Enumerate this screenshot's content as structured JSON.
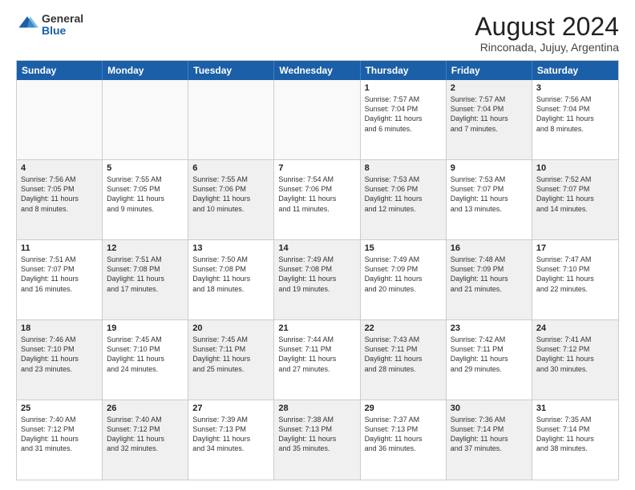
{
  "logo": {
    "general": "General",
    "blue": "Blue"
  },
  "header": {
    "month_year": "August 2024",
    "location": "Rinconada, Jujuy, Argentina"
  },
  "days_of_week": [
    "Sunday",
    "Monday",
    "Tuesday",
    "Wednesday",
    "Thursday",
    "Friday",
    "Saturday"
  ],
  "rows": [
    [
      {
        "day": "",
        "info": "",
        "shaded": false,
        "empty": true
      },
      {
        "day": "",
        "info": "",
        "shaded": false,
        "empty": true
      },
      {
        "day": "",
        "info": "",
        "shaded": false,
        "empty": true
      },
      {
        "day": "",
        "info": "",
        "shaded": false,
        "empty": true
      },
      {
        "day": "1",
        "info": "Sunrise: 7:57 AM\nSunset: 7:04 PM\nDaylight: 11 hours\nand 6 minutes.",
        "shaded": false,
        "empty": false
      },
      {
        "day": "2",
        "info": "Sunrise: 7:57 AM\nSunset: 7:04 PM\nDaylight: 11 hours\nand 7 minutes.",
        "shaded": true,
        "empty": false
      },
      {
        "day": "3",
        "info": "Sunrise: 7:56 AM\nSunset: 7:04 PM\nDaylight: 11 hours\nand 8 minutes.",
        "shaded": false,
        "empty": false
      }
    ],
    [
      {
        "day": "4",
        "info": "Sunrise: 7:56 AM\nSunset: 7:05 PM\nDaylight: 11 hours\nand 8 minutes.",
        "shaded": true,
        "empty": false
      },
      {
        "day": "5",
        "info": "Sunrise: 7:55 AM\nSunset: 7:05 PM\nDaylight: 11 hours\nand 9 minutes.",
        "shaded": false,
        "empty": false
      },
      {
        "day": "6",
        "info": "Sunrise: 7:55 AM\nSunset: 7:06 PM\nDaylight: 11 hours\nand 10 minutes.",
        "shaded": true,
        "empty": false
      },
      {
        "day": "7",
        "info": "Sunrise: 7:54 AM\nSunset: 7:06 PM\nDaylight: 11 hours\nand 11 minutes.",
        "shaded": false,
        "empty": false
      },
      {
        "day": "8",
        "info": "Sunrise: 7:53 AM\nSunset: 7:06 PM\nDaylight: 11 hours\nand 12 minutes.",
        "shaded": true,
        "empty": false
      },
      {
        "day": "9",
        "info": "Sunrise: 7:53 AM\nSunset: 7:07 PM\nDaylight: 11 hours\nand 13 minutes.",
        "shaded": false,
        "empty": false
      },
      {
        "day": "10",
        "info": "Sunrise: 7:52 AM\nSunset: 7:07 PM\nDaylight: 11 hours\nand 14 minutes.",
        "shaded": true,
        "empty": false
      }
    ],
    [
      {
        "day": "11",
        "info": "Sunrise: 7:51 AM\nSunset: 7:07 PM\nDaylight: 11 hours\nand 16 minutes.",
        "shaded": false,
        "empty": false
      },
      {
        "day": "12",
        "info": "Sunrise: 7:51 AM\nSunset: 7:08 PM\nDaylight: 11 hours\nand 17 minutes.",
        "shaded": true,
        "empty": false
      },
      {
        "day": "13",
        "info": "Sunrise: 7:50 AM\nSunset: 7:08 PM\nDaylight: 11 hours\nand 18 minutes.",
        "shaded": false,
        "empty": false
      },
      {
        "day": "14",
        "info": "Sunrise: 7:49 AM\nSunset: 7:08 PM\nDaylight: 11 hours\nand 19 minutes.",
        "shaded": true,
        "empty": false
      },
      {
        "day": "15",
        "info": "Sunrise: 7:49 AM\nSunset: 7:09 PM\nDaylight: 11 hours\nand 20 minutes.",
        "shaded": false,
        "empty": false
      },
      {
        "day": "16",
        "info": "Sunrise: 7:48 AM\nSunset: 7:09 PM\nDaylight: 11 hours\nand 21 minutes.",
        "shaded": true,
        "empty": false
      },
      {
        "day": "17",
        "info": "Sunrise: 7:47 AM\nSunset: 7:10 PM\nDaylight: 11 hours\nand 22 minutes.",
        "shaded": false,
        "empty": false
      }
    ],
    [
      {
        "day": "18",
        "info": "Sunrise: 7:46 AM\nSunset: 7:10 PM\nDaylight: 11 hours\nand 23 minutes.",
        "shaded": true,
        "empty": false
      },
      {
        "day": "19",
        "info": "Sunrise: 7:45 AM\nSunset: 7:10 PM\nDaylight: 11 hours\nand 24 minutes.",
        "shaded": false,
        "empty": false
      },
      {
        "day": "20",
        "info": "Sunrise: 7:45 AM\nSunset: 7:11 PM\nDaylight: 11 hours\nand 25 minutes.",
        "shaded": true,
        "empty": false
      },
      {
        "day": "21",
        "info": "Sunrise: 7:44 AM\nSunset: 7:11 PM\nDaylight: 11 hours\nand 27 minutes.",
        "shaded": false,
        "empty": false
      },
      {
        "day": "22",
        "info": "Sunrise: 7:43 AM\nSunset: 7:11 PM\nDaylight: 11 hours\nand 28 minutes.",
        "shaded": true,
        "empty": false
      },
      {
        "day": "23",
        "info": "Sunrise: 7:42 AM\nSunset: 7:11 PM\nDaylight: 11 hours\nand 29 minutes.",
        "shaded": false,
        "empty": false
      },
      {
        "day": "24",
        "info": "Sunrise: 7:41 AM\nSunset: 7:12 PM\nDaylight: 11 hours\nand 30 minutes.",
        "shaded": true,
        "empty": false
      }
    ],
    [
      {
        "day": "25",
        "info": "Sunrise: 7:40 AM\nSunset: 7:12 PM\nDaylight: 11 hours\nand 31 minutes.",
        "shaded": false,
        "empty": false
      },
      {
        "day": "26",
        "info": "Sunrise: 7:40 AM\nSunset: 7:12 PM\nDaylight: 11 hours\nand 32 minutes.",
        "shaded": true,
        "empty": false
      },
      {
        "day": "27",
        "info": "Sunrise: 7:39 AM\nSunset: 7:13 PM\nDaylight: 11 hours\nand 34 minutes.",
        "shaded": false,
        "empty": false
      },
      {
        "day": "28",
        "info": "Sunrise: 7:38 AM\nSunset: 7:13 PM\nDaylight: 11 hours\nand 35 minutes.",
        "shaded": true,
        "empty": false
      },
      {
        "day": "29",
        "info": "Sunrise: 7:37 AM\nSunset: 7:13 PM\nDaylight: 11 hours\nand 36 minutes.",
        "shaded": false,
        "empty": false
      },
      {
        "day": "30",
        "info": "Sunrise: 7:36 AM\nSunset: 7:14 PM\nDaylight: 11 hours\nand 37 minutes.",
        "shaded": true,
        "empty": false
      },
      {
        "day": "31",
        "info": "Sunrise: 7:35 AM\nSunset: 7:14 PM\nDaylight: 11 hours\nand 38 minutes.",
        "shaded": false,
        "empty": false
      }
    ]
  ]
}
